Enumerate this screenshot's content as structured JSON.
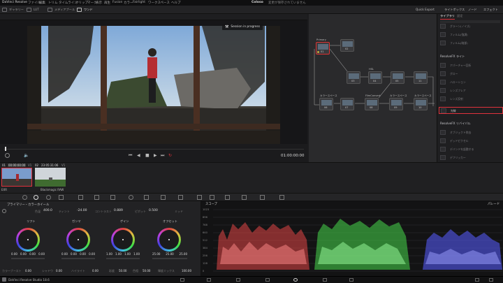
{
  "titlebar": {
    "app_name": "DaVinci Resolve",
    "menus": [
      "ファイル",
      "編集",
      "トリム",
      "タイムライン",
      "クリップ",
      "マーク",
      "表示",
      "再生",
      "Fusion",
      "カラー",
      "Fairlight",
      "ワークスペース",
      "ヘルプ"
    ],
    "project": "Coloso",
    "subtitle": "変更が保存されていません"
  },
  "toolbar": {
    "zoom": "55%",
    "timeline": "Timeline 1",
    "timecode": "00:00:00:00",
    "clip_label": "クリップ",
    "quick_export": "Quick Export",
    "lightbox": "ライトボックス",
    "nodes": "ノード",
    "effects": "エフェクト",
    "left_labels": [
      "ギャラリー",
      "LUT",
      "メディアプール",
      "ワンド"
    ]
  },
  "viewer": {
    "session_badge": "Session in progress",
    "timecode": "01:00:00:00"
  },
  "nodes": [
    {
      "label": "Primary",
      "num": "01"
    },
    {
      "label": "02",
      "num": "02"
    },
    {
      "label": "カラー",
      "num": "03"
    },
    {
      "label": "HSL",
      "num": "04"
    },
    {
      "label": "",
      "num": "05"
    },
    {
      "label": "カラースペース",
      "num": "06"
    },
    {
      "label": "",
      "num": "07"
    },
    {
      "label": "FilmConvert",
      "num": "08"
    },
    {
      "label": "カラースペース",
      "num": "09"
    },
    {
      "label": "カラースペース",
      "num": "10"
    },
    {
      "label": "",
      "num": "11"
    }
  ],
  "library": {
    "tabs": [
      "ライブラリ",
      "設定"
    ],
    "items_top": [
      "グラーン(ノイズ)",
      "フィルム(強調)",
      "フィルム(暗部)"
    ],
    "section_light": "ResolveFX ライト",
    "items_light": [
      "アパーチャー回折",
      "グロー",
      "ハローション",
      "レンズフレア",
      "レンズ反射",
      "光線"
    ],
    "section_revival": "ResolveFX リバイバル",
    "items_revival": [
      "オブジェクト除去",
      "デッドピクセル",
      "デバンドを起動する",
      "デフリッカー"
    ]
  },
  "clips": [
    {
      "num": "01",
      "timecode": "00:00:00:00",
      "track": "V1",
      "name": "EXR"
    },
    {
      "num": "02",
      "timecode": "23:05:31:06",
      "track": "V1",
      "name": "Blackmagic RAW"
    }
  ],
  "primaries": {
    "title": "プライマリー・カラーホイール",
    "temp_label": "色温",
    "temp": "400.0",
    "tint_label": "ティント",
    "tint": "-24.00",
    "contrast_label": "コントラスト",
    "contrast": "0.889",
    "pivot_label": "ピボット",
    "pivot": "0.500",
    "mid_label": "ミッド",
    "wheels": [
      {
        "name": "リフト",
        "vals": [
          "0.00",
          "0.00",
          "0.00",
          "0.00"
        ]
      },
      {
        "name": "ガンマ",
        "vals": [
          "0.00",
          "0.00",
          "0.00",
          "0.00"
        ]
      },
      {
        "name": "ゲイン",
        "vals": [
          "1.00",
          "1.00",
          "1.00",
          "1.00"
        ]
      },
      {
        "name": "オフセット",
        "vals": [
          "25.00",
          "25.00",
          "25.00"
        ]
      }
    ],
    "bottom": [
      {
        "label": "カラーブースト",
        "val": "0.00"
      },
      {
        "label": "シャドウ",
        "val": "0.00"
      },
      {
        "label": "ハイライト",
        "val": "0.00"
      },
      {
        "label": "彩度",
        "val": "50.00"
      },
      {
        "label": "色相",
        "val": "50.00"
      },
      {
        "label": "輝度ミックス",
        "val": "100.00"
      }
    ]
  },
  "scope": {
    "title": "スコープ",
    "mode": "パレード",
    "scale": [
      "1023",
      "896",
      "768",
      "640",
      "512",
      "384",
      "256",
      "128",
      "0"
    ]
  },
  "status": {
    "app": "DaVinci Resolve Studio 18.6"
  },
  "colors": {
    "accent_red": "#e0323c",
    "node_dot": "#c2a93c",
    "scope_red": "#e24545",
    "scope_green": "#47d84a",
    "scope_blue": "#5358f0"
  }
}
